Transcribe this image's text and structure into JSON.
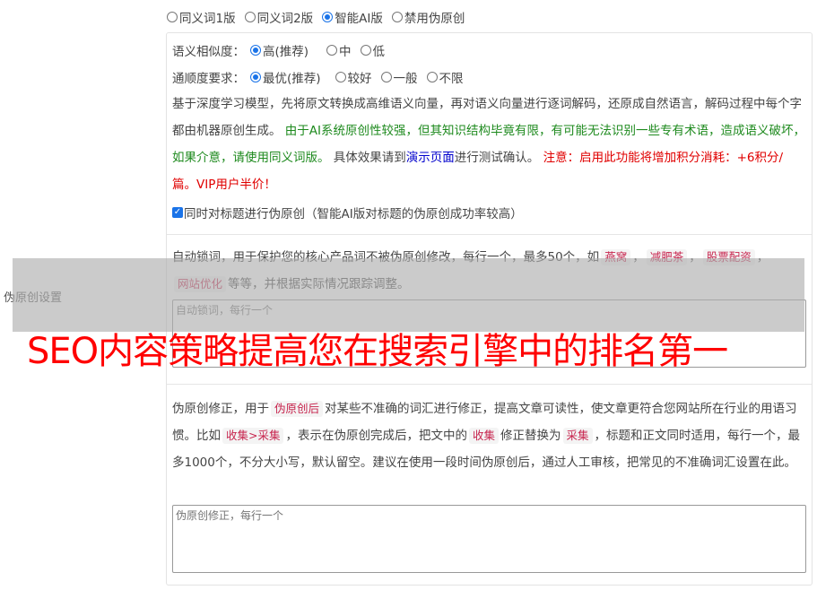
{
  "side_label": "伪原创设置",
  "versions": [
    {
      "label": "同义词1版",
      "selected": false
    },
    {
      "label": "同义词2版",
      "selected": false
    },
    {
      "label": "智能AI版",
      "selected": true
    },
    {
      "label": "禁用伪原创",
      "selected": false
    }
  ],
  "similarity": {
    "label": "语义相似度：",
    "options": [
      {
        "label": "高(推荐)",
        "selected": true
      },
      {
        "label": "中",
        "selected": false
      },
      {
        "label": "低",
        "selected": false
      }
    ]
  },
  "fluency": {
    "label": "通顺度要求：",
    "options": [
      {
        "label": "最优(推荐)",
        "selected": true
      },
      {
        "label": "较好",
        "selected": false
      },
      {
        "label": "一般",
        "selected": false
      },
      {
        "label": "不限",
        "selected": false
      }
    ]
  },
  "ai_desc": {
    "intro": "基于深度学习模型，先将原文转换成高维语义向量，再对语义向量进行逐词解码，还原成自然语言，解码过程中每个字都由机器原创生成。",
    "warning_green": "由于AI系统原创性较强，但其知识结构毕竟有限，有可能无法识别一些专有术语，造成语义破坏，如果介意，请使用同义词版。",
    "demo_prefix": "具体效果请到",
    "demo_link": "演示页面",
    "demo_suffix": "进行测试确认。",
    "cost_red": "注意：启用此功能将增加积分消耗：+6积分/篇。VIP用户半价！"
  },
  "title_checkbox": {
    "label": "同时对标题进行伪原创（智能AI版对标题的伪原创成功率较高）",
    "checked": true
  },
  "lock_words": {
    "prefix": "自动锁词，用于保护您的核心产品词不被伪原创修改，每行一个，最多50个，如",
    "examples": [
      "燕窝",
      "减肥茶",
      "股票配资",
      "网站优化"
    ],
    "suffix": "等等，并根据实际情况跟踪调整。",
    "placeholder": "自动锁词，每行一个"
  },
  "correction": {
    "prefix": "伪原创修正，用于",
    "kw1": "伪原创后",
    "mid1": "对某些不准确的词汇进行修正，提高文章可读性，使文章更符合您网站所在行业的用语习惯。比如",
    "kw2": "收集>采集",
    "mid2": "，表示在伪原创完成后，把文中的",
    "kw3": "收集",
    "mid3": "修正替换为",
    "kw4": "采集",
    "suffix": "，标题和正文同时适用，每行一个，最多1000个，不分大小写，默认留空。建议在使用一段时间伪原创后，通过人工审核，把常见的不准确词汇设置在此。",
    "placeholder": "伪原创修正，每行一个"
  },
  "overlay_banner": "SEO内容策略提高您在搜索引擎中的排名第一"
}
